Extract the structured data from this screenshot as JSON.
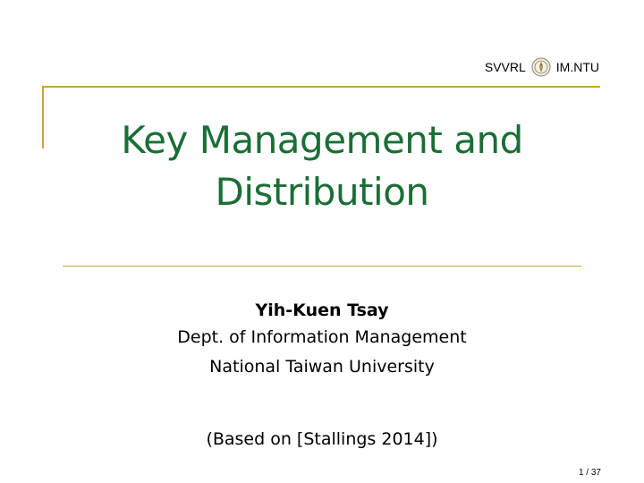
{
  "header": {
    "left_text": "SVVRL",
    "right_text": "IM.NTU",
    "logo_icon": "university-seal-icon"
  },
  "slide": {
    "title_line1": "Key Management and",
    "title_line2": "Distribution",
    "author": "Yih-Kuen Tsay",
    "department": "Dept. of Information Management",
    "university": "National Taiwan University",
    "note": "(Based on [Stallings 2014])"
  },
  "footer": {
    "page": "1 / 37"
  },
  "colors": {
    "title": "#1a6e35",
    "accent": "#c9a53a"
  }
}
